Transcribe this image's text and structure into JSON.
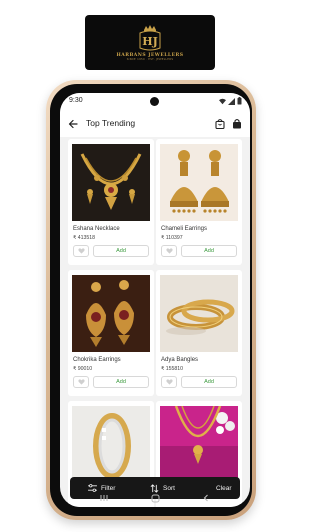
{
  "brand": {
    "monogram": "HJ",
    "name": "HARBANS JEWELLERS",
    "tagline": "SINCE 1950 · EST. JEWELLERS"
  },
  "status_bar": {
    "time": "9:30"
  },
  "app_bar": {
    "title": "Top Trending",
    "back_icon": "back-arrow-icon",
    "cart_icon": "shopping-bag-icon",
    "bag_icon": "lock-bag-icon"
  },
  "products": [
    {
      "name": "Eshana Necklace",
      "price": "₹ 413518",
      "add_label": "Add",
      "image": "gold-necklace"
    },
    {
      "name": "Chameli Earrings",
      "price": "₹ 110397",
      "add_label": "Add",
      "image": "gold-jhumka"
    },
    {
      "name": "Chokrika Earrings",
      "price": "₹ 90010",
      "add_label": "Add",
      "image": "gold-drop-earrings"
    },
    {
      "name": "Adya Bangles",
      "price": "₹ 155810",
      "add_label": "Add",
      "image": "gold-bangles"
    },
    {
      "name": "",
      "price": "",
      "add_label": "",
      "image": "two-tone-ring"
    },
    {
      "name": "",
      "price": "",
      "add_label": "",
      "image": "long-necklace"
    }
  ],
  "bottom_bar": {
    "filter_label": "Filter",
    "sort_label": "Sort",
    "clear_label": "Clear"
  },
  "colors": {
    "accent_green": "#3b9a3e",
    "gold": "#c9a24a",
    "bar_dark": "#171717"
  }
}
